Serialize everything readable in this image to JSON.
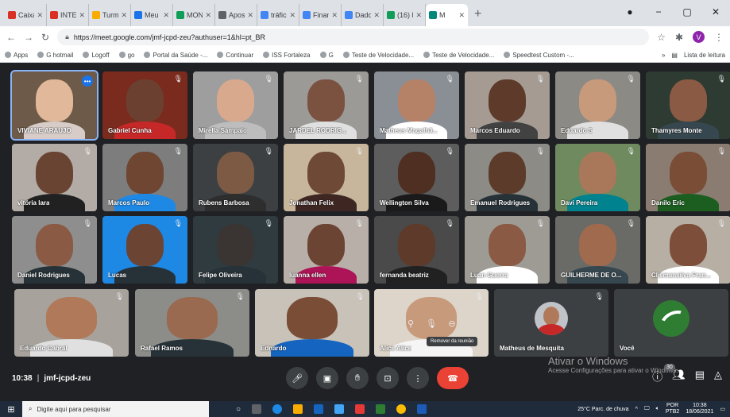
{
  "browser": {
    "tabs": [
      {
        "label": "Caixa",
        "color": "#d93025"
      },
      {
        "label": "INTEGR",
        "color": "#d93025"
      },
      {
        "label": "Turma",
        "color": "#f9ab00"
      },
      {
        "label": "Meu D",
        "color": "#1a73e8"
      },
      {
        "label": "MONI",
        "color": "#0f9d58"
      },
      {
        "label": "Aposti",
        "color": "#5f6368"
      },
      {
        "label": "tráfico",
        "color": "#4285f4"
      },
      {
        "label": "Finanç",
        "color": "#4285f4"
      },
      {
        "label": "Dados",
        "color": "#4285f4"
      },
      {
        "label": "(16) R",
        "color": "#0f9d58"
      },
      {
        "label": "M",
        "color": "#00897b",
        "active": true
      }
    ],
    "url": "https://meet.google.com/jmf-jcpd-zeu?authuser=1&hl=pt_BR",
    "profile_initial": "V",
    "bookmarks": [
      "Apps",
      "G hotmail",
      "Logoff",
      "go",
      "Portal da Saúde -...",
      "Continuar",
      "ISS Fortaleza",
      "G",
      "Teste de Velocidade...",
      "Teste de Velocidade...",
      "Speedtest Custom -..."
    ],
    "reading_list": "Lista de leitura"
  },
  "participants": [
    {
      "name": "VIVIANE ARAUJO",
      "bg": "#6d5a48",
      "skin": "#e2b89a",
      "shirt": "#d7ccc8",
      "active": true
    },
    {
      "name": "Gabriel Cunha",
      "bg": "#7a2b1e",
      "skin": "#6b4030",
      "shirt": "#c62828"
    },
    {
      "name": "Mirella Sampaio",
      "bg": "#9e9e9e",
      "skin": "#d9a98e",
      "shirt": "#bdbdbd"
    },
    {
      "name": "JARDEL RODRIG...",
      "bg": "#9c9a96",
      "skin": "#7b5140",
      "shirt": "#e0e0e0"
    },
    {
      "name": "Matheus Magalhã...",
      "bg": "#8a8f96",
      "skin": "#b58268",
      "shirt": "#ffffff"
    },
    {
      "name": "Marcos Eduardo",
      "bg": "#a59b93",
      "skin": "#5d3a2a",
      "shirt": "#424242"
    },
    {
      "name": "Eduardo S",
      "bg": "#8c8a84",
      "skin": "#c89a7c",
      "shirt": "#e0e0e0"
    },
    {
      "name": "Thamyres Monte",
      "bg": "#2e3b33",
      "skin": "#8a5a44",
      "shirt": "#37474f"
    },
    {
      "name": "vitória lara",
      "bg": "#b3aca6",
      "skin": "#6a4433",
      "shirt": "#212121"
    },
    {
      "name": "Marcos Paulo",
      "bg": "#7d7d7d",
      "skin": "#6e4632",
      "shirt": "#1e88e5"
    },
    {
      "name": "Rubens Barbosa",
      "bg": "#3c4043",
      "skin": "#7d5a44",
      "shirt": "#2e2e2e"
    },
    {
      "name": "Jonathan Felix",
      "bg": "#c7b69b",
      "skin": "#6e4a36",
      "shirt": "#3e2723"
    },
    {
      "name": "Wellington Silva",
      "bg": "#5d5d5d",
      "skin": "#4e2f22",
      "shirt": "#1a1a1a"
    },
    {
      "name": "Emanuel Rodrigues",
      "bg": "#8d8b85",
      "skin": "#5c3b2b",
      "shirt": "#263238"
    },
    {
      "name": "Davi Pereira",
      "bg": "#6f8a5e",
      "skin": "#a9775a",
      "shirt": "#00838f"
    },
    {
      "name": "Danilo Eric",
      "bg": "#8a7c70",
      "skin": "#7a4d37",
      "shirt": "#1b5e20"
    },
    {
      "name": "Daniel Rodrigues",
      "bg": "#8e8e8e",
      "skin": "#8a5a44",
      "shirt": "#263238"
    },
    {
      "name": "Lucas",
      "bg": "#1e88e5",
      "skin": "#6b4434",
      "shirt": "#263238"
    },
    {
      "name": "Felipe Oliveira",
      "bg": "#2f3b3f",
      "skin": "#3a3532",
      "shirt": "#263238"
    },
    {
      "name": "luanna ellen",
      "bg": "#b8b0a8",
      "skin": "#6b4434",
      "shirt": "#ad1457"
    },
    {
      "name": "fernanda beatriz",
      "bg": "#4a4a4a",
      "skin": "#5e3a2a",
      "shirt": "#212121"
    },
    {
      "name": "Luan Guerra",
      "bg": "#9e9a94",
      "skin": "#8a5a44",
      "shirt": "#ffffff"
    },
    {
      "name": "GUILHERME DE O...",
      "bg": "#6a6a66",
      "skin": "#a06a4e",
      "shirt": "#37474f"
    },
    {
      "name": "Clismansilva Fran...",
      "bg": "#b7afa4",
      "skin": "#7d4f3a",
      "shirt": "#ffffff"
    },
    {
      "name": "Eduardo Cabral",
      "bg": "#a7a29c",
      "skin": "#b07a5a",
      "shirt": "#e0e0e0"
    },
    {
      "name": "Rafael Ramos",
      "bg": "#8c8c88",
      "skin": "#9a6a50",
      "shirt": "#263238"
    },
    {
      "name": "Ednardo",
      "bg": "#c9c2b8",
      "skin": "#7a4d37",
      "shirt": "#1565c0"
    },
    {
      "name": "Alice Alice",
      "bg": "#ddd5ca",
      "skin": "#c89a7c",
      "shirt": "#f5f5f5",
      "hover": true
    },
    {
      "name": "Matheus de Mesquita",
      "bg": "#3c4043",
      "avatar": "photo"
    },
    {
      "name": "Você",
      "bg": "#3c4043",
      "avatar": "logo"
    }
  ],
  "hover_tooltip": "Remover da reunião",
  "meeting": {
    "time": "10:38",
    "code": "jmf-jcpd-zeu",
    "participant_badge": "30"
  },
  "watermark": {
    "line1": "Ativar o Windows",
    "line2": "Acesse Configurações para ativar o Windows."
  },
  "taskbar": {
    "search_placeholder": "Digite aqui para pesquisar",
    "weather": "25°C Parc. de chuva",
    "lang": "POR",
    "lang2": "PTB2",
    "time": "10:38",
    "date": "18/06/2021"
  }
}
